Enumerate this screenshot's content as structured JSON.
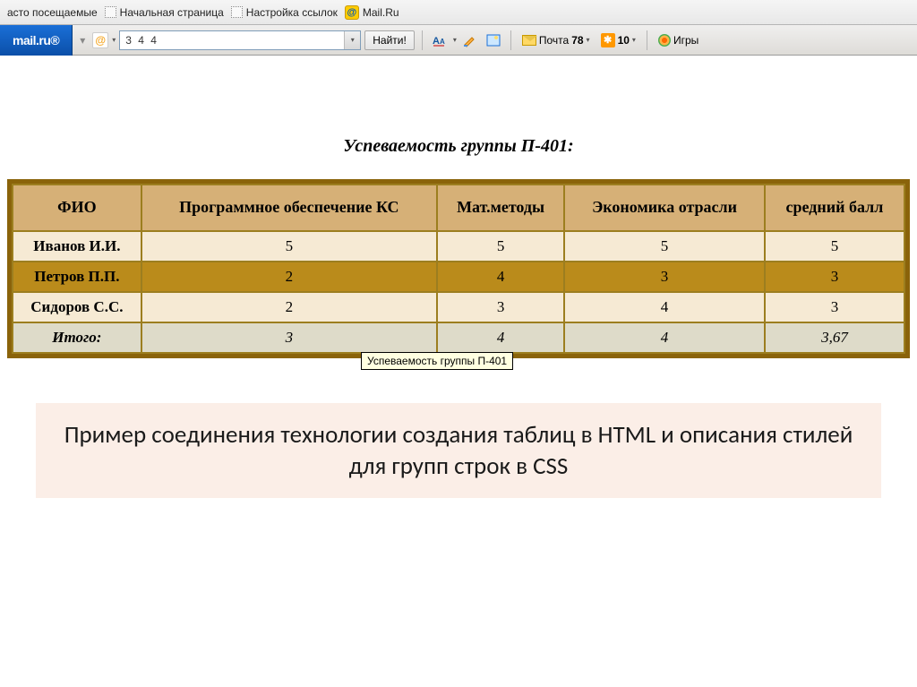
{
  "bookmarks": {
    "freq_visited": "асто посещаемые",
    "start_page": "Начальная страница",
    "link_settings": "Настройка ссылок",
    "mailru": "Mail.Ru"
  },
  "toolbar": {
    "logo": "mail.ru®",
    "search_value": "3   4   4",
    "find_label": "Найти!",
    "mail_label": "Почта",
    "mail_count": "78",
    "ok_count": "10",
    "games_label": "Игры"
  },
  "slide": {
    "title": "Успеваемость группы П-401:",
    "headers": [
      "ФИО",
      "Программное обеспечение КС",
      "Мат.методы",
      "Экономика отрасли",
      "средний балл"
    ],
    "rows": [
      {
        "name": "Иванов И.И.",
        "c1": "5",
        "c2": "5",
        "c3": "5",
        "c4": "5",
        "cls": "row-odd"
      },
      {
        "name": "Петров П.П.",
        "c1": "2",
        "c2": "4",
        "c3": "3",
        "c4": "3",
        "cls": "row-even"
      },
      {
        "name": "Сидоров С.С.",
        "c1": "2",
        "c2": "3",
        "c3": "4",
        "c4": "3",
        "cls": "row-odd"
      }
    ],
    "total": {
      "name": "Итого:",
      "c1": "3",
      "c2": "4",
      "c3": "4",
      "c4": "3,67"
    },
    "tooltip": "Успеваемость группы П-401",
    "caption": "Пример соединения технологии создания таблиц в HTML  и описания стилей для групп строк в CSS"
  }
}
